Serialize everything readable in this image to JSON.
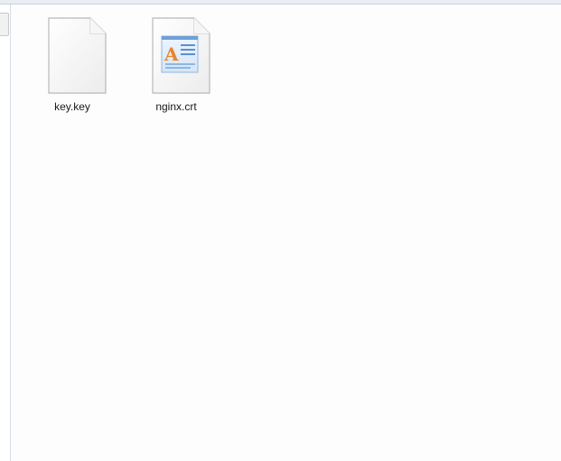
{
  "files": [
    {
      "name": "key.key",
      "icon": "blank-file-icon"
    },
    {
      "name": "nginx.crt",
      "icon": "wordpad-document-icon"
    }
  ],
  "colors": {
    "icon_letter": "#e8862a",
    "icon_lines": "#5b8fd1"
  }
}
